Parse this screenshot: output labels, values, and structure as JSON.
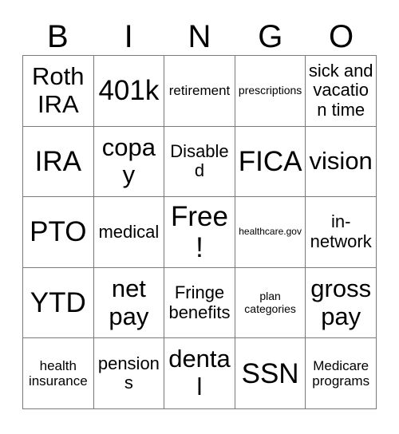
{
  "card": {
    "title_letters": [
      "B",
      "I",
      "N",
      "G",
      "O"
    ],
    "free_space_label": "Free!",
    "colors": {
      "border": "#7a7a7a",
      "background": "#ffffff",
      "text": "#000000"
    },
    "rows": [
      [
        {
          "text": "Roth IRA",
          "size": "xl"
        },
        {
          "text": "401k",
          "size": "xxl"
        },
        {
          "text": "retirement",
          "size": "sm"
        },
        {
          "text": "prescriptions",
          "size": "xs"
        },
        {
          "text": "sick and vacation time",
          "size": "md"
        }
      ],
      [
        {
          "text": "IRA",
          "size": "xxl"
        },
        {
          "text": "copay",
          "size": "xl"
        },
        {
          "text": "Disabled",
          "size": "md"
        },
        {
          "text": "FICA",
          "size": "xxl"
        },
        {
          "text": "vision",
          "size": "xl"
        }
      ],
      [
        {
          "text": "PTO",
          "size": "xxl"
        },
        {
          "text": "medical",
          "size": "md"
        },
        {
          "text": "Free!",
          "size": "xxl"
        },
        {
          "text": "healthcare.gov",
          "size": "xxs"
        },
        {
          "text": "in-network",
          "size": "md"
        }
      ],
      [
        {
          "text": "YTD",
          "size": "xxl"
        },
        {
          "text": "net pay",
          "size": "xl"
        },
        {
          "text": "Fringe benefits",
          "size": "md"
        },
        {
          "text": "plan categories",
          "size": "xs"
        },
        {
          "text": "gross pay",
          "size": "xl"
        }
      ],
      [
        {
          "text": "health insurance",
          "size": "sm"
        },
        {
          "text": "pensions",
          "size": "md"
        },
        {
          "text": "dental",
          "size": "xl"
        },
        {
          "text": "SSN",
          "size": "xxl"
        },
        {
          "text": "Medicare programs",
          "size": "sm"
        }
      ]
    ]
  }
}
